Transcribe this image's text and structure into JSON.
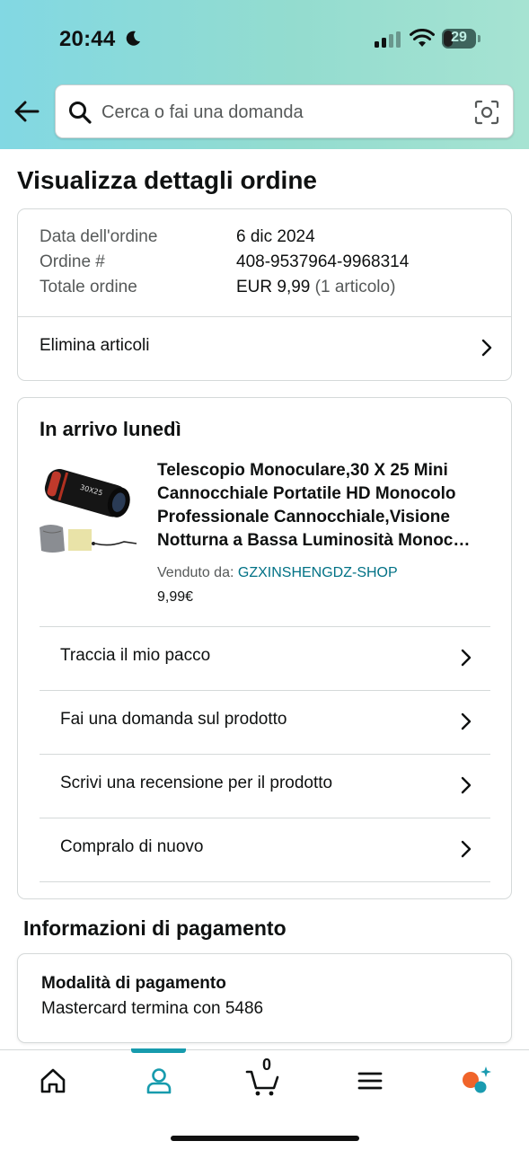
{
  "status_bar": {
    "time": "20:44",
    "battery": "29"
  },
  "search": {
    "placeholder": "Cerca o fai una domanda"
  },
  "page_title": "Visualizza dettagli ordine",
  "order_summary": {
    "rows": [
      {
        "label": "Data dell'ordine",
        "value": "6 dic 2024"
      },
      {
        "label": "Ordine #",
        "value": "408-9537964-9968314"
      },
      {
        "label": "Totale ordine",
        "value": "EUR 9,99",
        "extra": "(1 articolo)"
      }
    ],
    "delete_items_label": "Elimina articoli"
  },
  "shipment": {
    "status": "In arrivo lunedì",
    "product": {
      "title_lines": [
        "Telescopio Monoculare,30 X 25 Mini",
        "Cannocchiale Portatile HD Monocolo",
        "Professionale Cannocchiale,Visione",
        "Notturna a Bassa Luminosità Monoc…"
      ],
      "seller_prefix": "Venduto da:",
      "seller_name": "GZXINSHENGDZ-SHOP",
      "price": "9,99€",
      "image_text": "30X25"
    },
    "actions": [
      "Traccia il mio pacco",
      "Fai una domanda sul prodotto",
      "Scrivi una recensione per il prodotto",
      "Compralo di nuovo"
    ]
  },
  "payment": {
    "section_title": "Informazioni di pagamento",
    "method_title": "Modalità di pagamento",
    "method_value": "Mastercard termina con 5486"
  },
  "tab_bar": {
    "tabs": [
      "home-icon",
      "account-icon",
      "cart-icon",
      "menu-icon",
      "rufus-icon"
    ],
    "active": "account-icon",
    "cart_count": "0",
    "accent_color": "#179bad"
  }
}
